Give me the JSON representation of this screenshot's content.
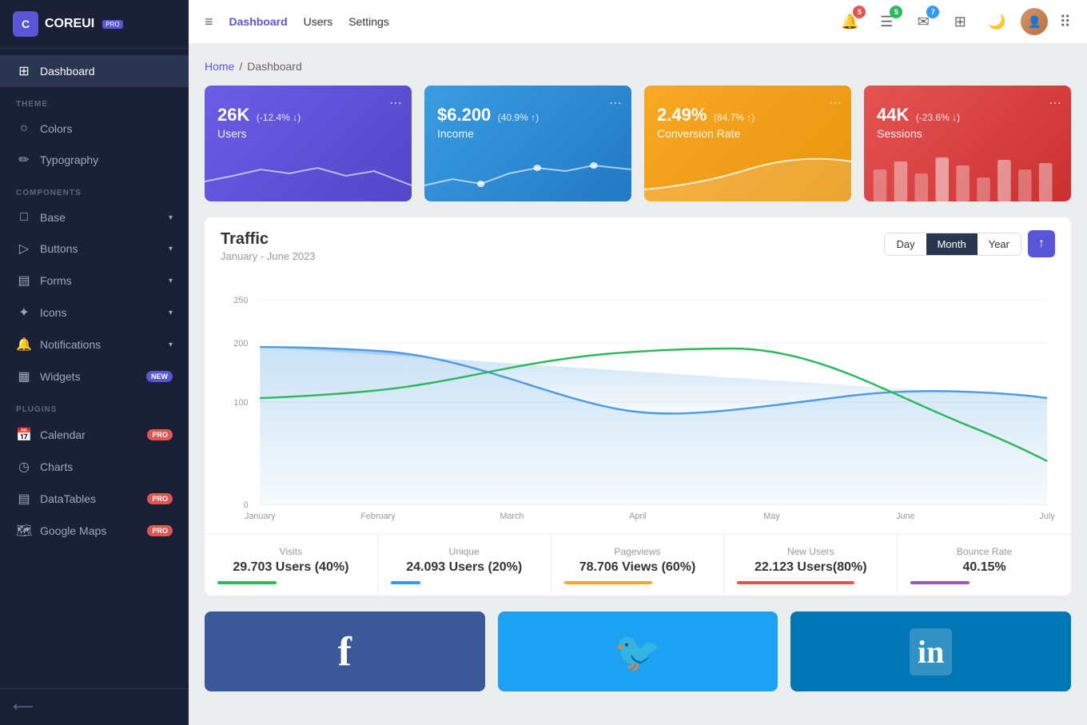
{
  "sidebar": {
    "logo_text": "COREUI",
    "logo_badge": "PRO",
    "logo_icon": "C",
    "dashboard_label": "Dashboard",
    "theme_section": "THEME",
    "components_section": "COMPONENTS",
    "plugins_section": "PLUGINS",
    "items": [
      {
        "id": "dashboard",
        "label": "Dashboard",
        "icon": "⊞",
        "active": true
      },
      {
        "id": "colors",
        "label": "Colors",
        "icon": "○"
      },
      {
        "id": "typography",
        "label": "Typography",
        "icon": "✏"
      },
      {
        "id": "base",
        "label": "Base",
        "icon": "□",
        "arrow": true
      },
      {
        "id": "buttons",
        "label": "Buttons",
        "icon": "▷",
        "arrow": true
      },
      {
        "id": "forms",
        "label": "Forms",
        "icon": "▤",
        "arrow": true
      },
      {
        "id": "icons",
        "label": "Icons",
        "icon": "✦",
        "arrow": true
      },
      {
        "id": "notifications",
        "label": "Notifications",
        "icon": "🔔",
        "arrow": true
      },
      {
        "id": "widgets",
        "label": "Widgets",
        "icon": "▦",
        "badge": "NEW",
        "badgeColor": "purple"
      },
      {
        "id": "calendar",
        "label": "Calendar",
        "icon": "📅",
        "badge": "PRO",
        "badgeColor": "red"
      },
      {
        "id": "charts",
        "label": "Charts",
        "icon": "◷"
      },
      {
        "id": "datatables",
        "label": "DataTables",
        "icon": "▤",
        "badge": "PRO",
        "badgeColor": "red"
      },
      {
        "id": "googlemaps",
        "label": "Google Maps",
        "icon": "🗺",
        "badge": "PRO",
        "badgeColor": "red"
      }
    ]
  },
  "topbar": {
    "nav_items": [
      "Dashboard",
      "Users",
      "Settings"
    ],
    "active_nav": "Dashboard",
    "badge_notifications": "5",
    "badge_tasks": "5",
    "badge_messages": "7"
  },
  "breadcrumb": {
    "home": "Home",
    "current": "Dashboard"
  },
  "stats": [
    {
      "id": "users",
      "value": "26K",
      "change": "(-12.4% ↓)",
      "label": "Users",
      "color": "purple"
    },
    {
      "id": "income",
      "value": "$6.200",
      "change": "(40.9% ↑)",
      "label": "Income",
      "color": "blue"
    },
    {
      "id": "conversion",
      "value": "2.49%",
      "change": "(84.7% ↑)",
      "label": "Conversion Rate",
      "color": "orange"
    },
    {
      "id": "sessions",
      "value": "44K",
      "change": "(-23.6% ↓)",
      "label": "Sessions",
      "color": "red"
    }
  ],
  "traffic": {
    "title": "Traffic",
    "subtitle": "January - June 2023",
    "period_day": "Day",
    "period_month": "Month",
    "period_year": "Year",
    "active_period": "Month",
    "y_labels": [
      "250",
      "200",
      "100",
      "0"
    ],
    "x_labels": [
      "January",
      "February",
      "March",
      "April",
      "May",
      "June",
      "July"
    ],
    "footer": [
      {
        "label": "Visits",
        "value": "29.703 Users (40%)",
        "bar_color": "#2eb85c"
      },
      {
        "label": "Unique",
        "value": "24.093 Users (20%)",
        "bar_color": "#3399ff"
      },
      {
        "label": "Pageviews",
        "value": "78.706 Views (60%)",
        "bar_color": "#f9a825"
      },
      {
        "label": "New Users",
        "value": "22.123 Users(80%)",
        "bar_color": "#e55353"
      },
      {
        "label": "Bounce Rate",
        "value": "40.15%",
        "bar_color": "#9b59b6"
      }
    ]
  },
  "social": [
    {
      "id": "facebook",
      "icon": "f",
      "color": "#3b5998"
    },
    {
      "id": "twitter",
      "icon": "🐦",
      "color": "#1da1f2"
    },
    {
      "id": "linkedin",
      "icon": "in",
      "color": "#0077b5"
    }
  ]
}
